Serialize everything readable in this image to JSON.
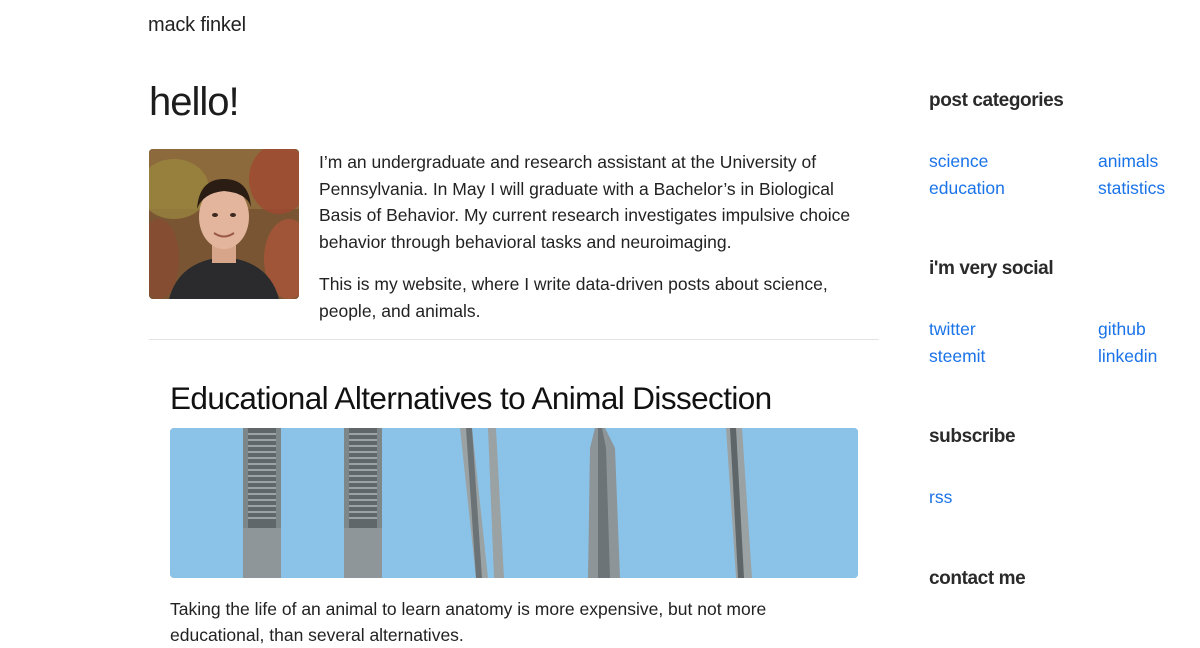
{
  "site": {
    "title": "mack finkel"
  },
  "main": {
    "heading": "hello!",
    "intro_paragraphs": [
      "I’m an undergraduate and research assistant at the University of Pennsylvania. In May I will graduate with a Bachelor’s in Biological Basis of Behavior. My current research investigates impulsive choice behavior through behavioral tasks and neuroimaging.",
      "This is my website, where I write data-driven posts about science, people, and animals."
    ]
  },
  "post": {
    "title": "Educational Alternatives to Animal Dissection",
    "excerpt": "Taking the life of an animal to learn anatomy is more expensive, but not more educational, than several alternatives."
  },
  "sidebar": {
    "categories": {
      "heading": "post categories",
      "links": [
        "science",
        "animals",
        "education",
        "statistics"
      ]
    },
    "social": {
      "heading": "i'm very social",
      "links": [
        "twitter",
        "github",
        "steemit",
        "linkedin"
      ]
    },
    "subscribe": {
      "heading": "subscribe",
      "links": [
        "rss"
      ]
    },
    "contact": {
      "heading": "contact me"
    }
  },
  "colors": {
    "link": "#1a73e8",
    "text": "#212529",
    "image_background": "#8bc3e8"
  }
}
